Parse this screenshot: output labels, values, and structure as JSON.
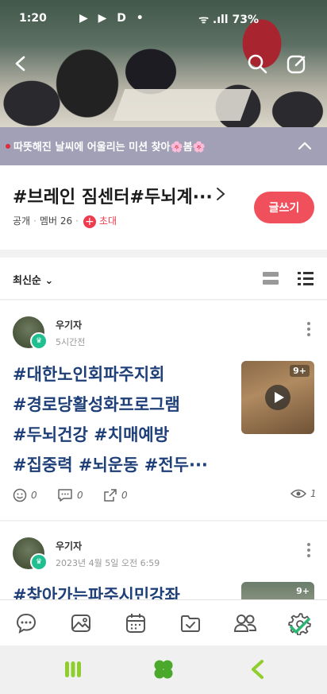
{
  "status": {
    "time": "1:20",
    "apps": "▶ ▶ D •",
    "system": "ᯤ .ıll 73%"
  },
  "notice": {
    "text": "따뜻해진 날씨에 어울리는 미션 찾아🌸봄🌸"
  },
  "band": {
    "title": "#브레인 짐센터#두뇌계···",
    "visibility": "공개",
    "members": "멤버 26",
    "invite_plus": "+",
    "invite": "초대",
    "write_button": "글쓰기"
  },
  "sort": {
    "label": "최신순 ⌄"
  },
  "posts": [
    {
      "author": "우기자",
      "time": "5시간전",
      "tags": [
        "#대한노인회파주지회",
        "#경로당활성화프로그램",
        "#두뇌건강 #치매예방",
        "#집중력 #뇌운동 #전두···"
      ],
      "media_count": "9+",
      "likes": "0",
      "comments": "0",
      "shares": "0",
      "views": "1"
    },
    {
      "author": "우기자",
      "time": "2023년 4월 5일 오전 6:59",
      "tags": [
        "#찾아가는파주시민강좌"
      ],
      "media_count": "9+"
    }
  ],
  "colors": {
    "accent": "#f0505c",
    "hashtag": "#1e3f78",
    "notice_bg": "#a2a0b6",
    "settings_check": "#2bb673"
  },
  "icons": {
    "tabs": [
      "chat-bubble-icon",
      "photo-icon",
      "calendar-icon",
      "folder-check-icon",
      "members-icon",
      "settings-icon"
    ],
    "nav": [
      "recent-apps-icon",
      "home-clover-icon",
      "back-icon"
    ]
  }
}
